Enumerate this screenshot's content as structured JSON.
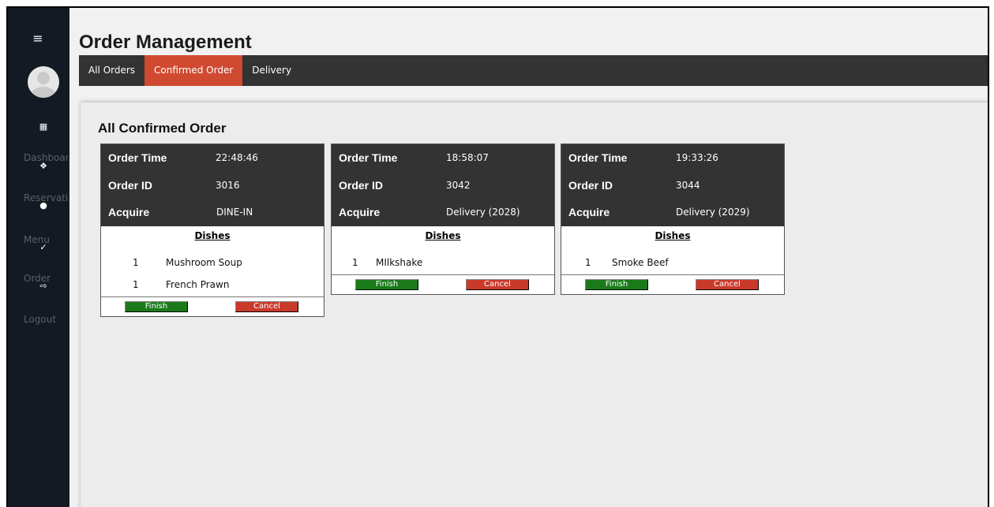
{
  "sidebar": {
    "menu_icon": "hamburger-icon",
    "items": [
      {
        "label": "Dashboard",
        "icon": "grid-icon"
      },
      {
        "label": "Reservation",
        "icon": "cube-icon"
      },
      {
        "label": "Menu",
        "icon": "chef-hat-icon"
      },
      {
        "label": "Order",
        "icon": "check-icon"
      },
      {
        "label": "Logout",
        "icon": "logout-icon"
      }
    ]
  },
  "header": {
    "title": "Order Management",
    "tabs": [
      {
        "label": "All Orders",
        "active": false
      },
      {
        "label": "Confirmed Order",
        "active": true
      },
      {
        "label": "Delivery",
        "active": false
      }
    ]
  },
  "main": {
    "section_title": "All Confirmed Order",
    "labels": {
      "order_time": "Order Time",
      "order_id": "Order ID",
      "acquire": "Acquire",
      "dishes": "Dishes",
      "finish": "Finish",
      "cancel": "Cancel"
    },
    "orders": [
      {
        "time": "22:48:46",
        "id": "3016",
        "acquire": "DINE-IN",
        "dishes": [
          {
            "qty": "1",
            "name": "Mushroom Soup"
          },
          {
            "qty": "1",
            "name": "French Prawn"
          }
        ]
      },
      {
        "time": "18:58:07",
        "id": "3042",
        "acquire": "Delivery (2028)",
        "dishes": [
          {
            "qty": "1",
            "name": "MIlkshake"
          }
        ]
      },
      {
        "time": "19:33:26",
        "id": "3044",
        "acquire": "Delivery (2029)",
        "dishes": [
          {
            "qty": "1",
            "name": "Smoke Beef"
          }
        ]
      }
    ]
  },
  "colors": {
    "sidebar_bg": "#131a23",
    "tabbar_bg": "#333333",
    "tab_active": "#d04a31",
    "finish_btn": "#1a7a1a",
    "cancel_btn": "#c93a2b"
  }
}
